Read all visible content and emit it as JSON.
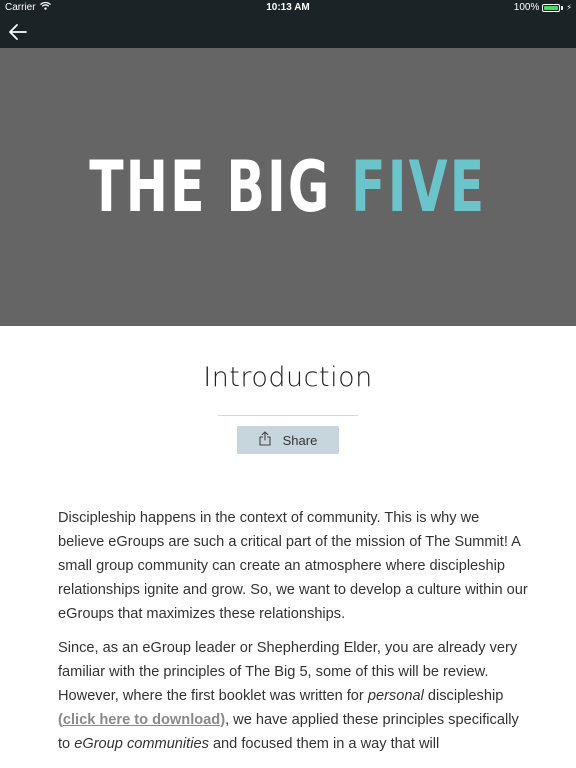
{
  "status_bar": {
    "carrier": "Carrier",
    "time": "10:13 AM",
    "battery": "100%",
    "battery_level": 1.0
  },
  "nav": {
    "back_icon": "arrow-left-icon"
  },
  "hero": {
    "title_main": "THE BIG ",
    "title_accent": "FIVE",
    "accent_color": "#6cc4cb",
    "background_color": "#656565"
  },
  "page": {
    "title": "Introduction",
    "share_label": "Share",
    "share_icon": "share-icon"
  },
  "article": {
    "p1": "Discipleship happens in the context of community. This is why we believe eGroups are such a critical part of the mission of The Summit! A small group community can create an atmosphere where discipleship relationships ignite and grow.  So, we want to develop a culture within our eGroups that maximizes these relationships.",
    "p2_part1": "Since, as an eGroup leader or Shepherding Elder, you are already very familiar with the principles of The Big 5, some of this will be review. However, where the first booklet was written for ",
    "p2_em1": "personal",
    "p2_part2": " discipleship ",
    "p2_paren_open": "(",
    "p2_link": "click here to download",
    "p2_paren_close": ")",
    "p2_part3": ", we have applied these principles specifically to ",
    "p2_em2": "eGroup communities",
    "p2_part4": " and focused them in a way that will"
  }
}
